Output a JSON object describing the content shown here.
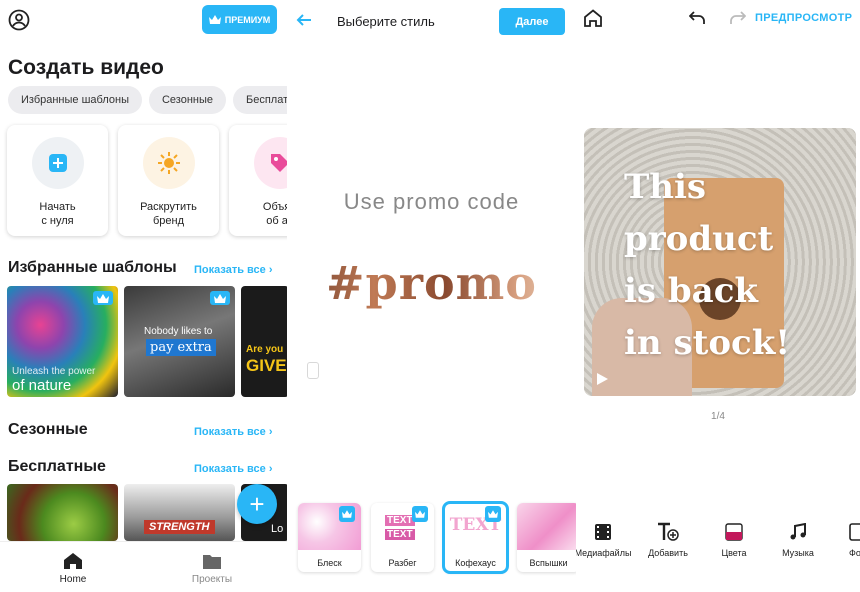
{
  "panel1": {
    "premium_label": "ПРЕМИУМ",
    "title": "Создать видео",
    "chips": [
      "Избранные шаблоны",
      "Сезонные",
      "Бесплат"
    ],
    "quick_cards": [
      {
        "label": "Начать\nс нуля",
        "icon": "plus-square-icon",
        "color": "#29b6f6"
      },
      {
        "label": "Раскрутить\nбренд",
        "icon": "sparkle-icon",
        "color": "#f5a623"
      },
      {
        "label": "Объяв\nоб ак",
        "icon": "tag-icon",
        "color": "#e94b9a"
      }
    ],
    "featured": {
      "title": "Избранные шаблоны",
      "more": "Показать все"
    },
    "featured_thumbs": [
      {
        "line1": "Unleash the power",
        "line2": "of nature"
      },
      {
        "line1": "Nobody likes to",
        "line2": "pay extra"
      },
      {
        "line1": "Are you",
        "line2": "GIVE"
      }
    ],
    "seasonal": {
      "title": "Сезонные",
      "more": "Показать все"
    },
    "free": {
      "title": "Бесплатные",
      "more": "Показать все"
    },
    "free_thumbs": [
      {
        "caption": ""
      },
      {
        "caption": "STRENGTH"
      },
      {
        "caption": "Lo"
      }
    ],
    "nav": [
      {
        "label": "Home",
        "icon": "home-icon"
      },
      {
        "label": "Проекты",
        "icon": "folder-icon"
      }
    ]
  },
  "panel2": {
    "title": "Выберите стиль",
    "next_label": "Далее",
    "promo_line1": "Use promo code",
    "promo_line2": "#promo",
    "styles": [
      {
        "label": "Блеск",
        "preview": ""
      },
      {
        "label": "Разбег",
        "preview": "TEXT"
      },
      {
        "label": "Кофехаус",
        "preview": "TEXT"
      },
      {
        "label": "Вспышки",
        "preview": ""
      }
    ],
    "selected_style": "Кофехаус"
  },
  "panel3": {
    "preview_label": "ПРЕДПРОСМОТР",
    "video_text": "This\nproduct\nis back\nin stock!",
    "pager": "1/4",
    "tools": [
      {
        "label": "Медиафайлы",
        "icon": "film-icon"
      },
      {
        "label": "Добавить",
        "icon": "add-text-icon"
      },
      {
        "label": "Цвета",
        "icon": "color-swatch-icon"
      },
      {
        "label": "Музыка",
        "icon": "music-icon"
      },
      {
        "label": "Фо",
        "icon": "font-icon"
      }
    ]
  }
}
